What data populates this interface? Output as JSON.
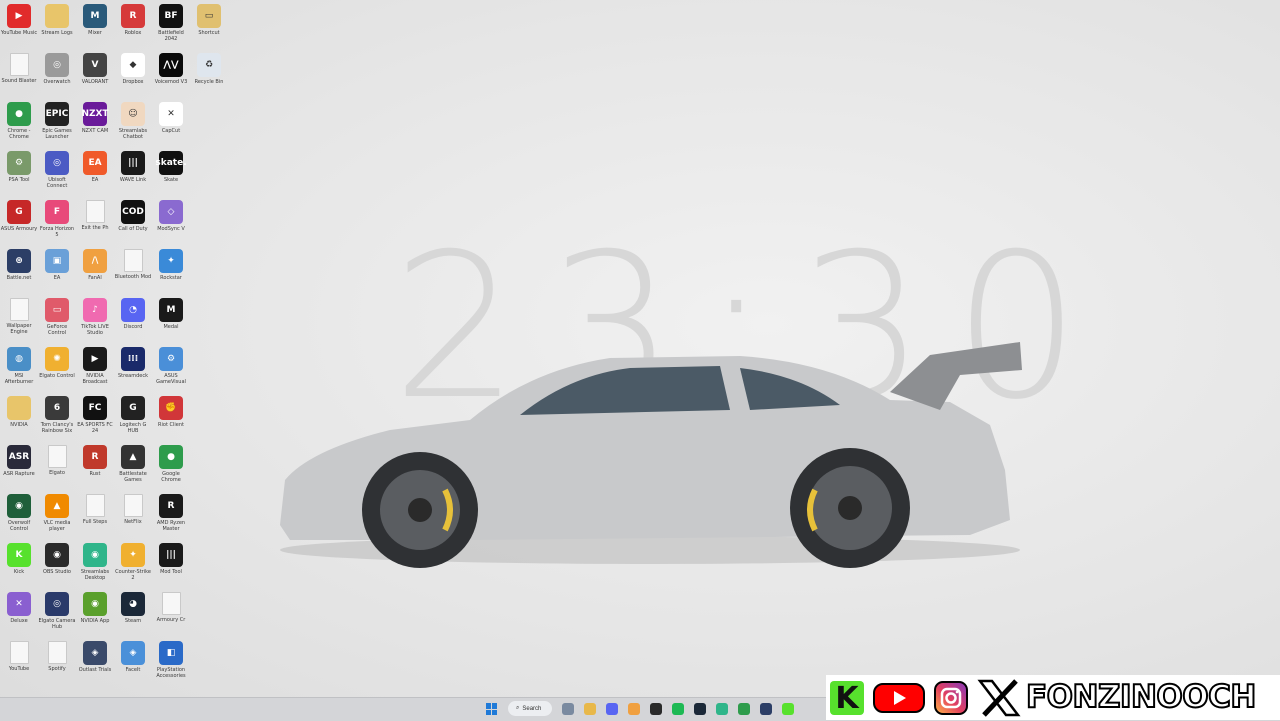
{
  "clock": {
    "time": "23:30"
  },
  "accent": "#1f7ad8",
  "desktop_icons": [
    {
      "label": "YouTube Music",
      "icon": "youtube-music-icon",
      "color": "#e12b2b",
      "text": "▶"
    },
    {
      "label": "Sound Blaster",
      "icon": "file-icon",
      "color": "",
      "text": ""
    },
    {
      "label": "Chrome - Chrome",
      "icon": "chrome-icon",
      "color": "#2e9c4c",
      "text": "●"
    },
    {
      "label": "PSA Tool",
      "icon": "tool-icon",
      "color": "#7a9a6a",
      "text": "⚙"
    },
    {
      "label": "ASUS Armoury",
      "icon": "asus-icon",
      "color": "#c62828",
      "text": "G"
    },
    {
      "label": "Battle.net",
      "icon": "battlenet-icon",
      "color": "#2c3e66",
      "text": "⊛"
    },
    {
      "label": "Wallpaper Engine",
      "icon": "file-icon",
      "color": "",
      "text": ""
    },
    {
      "label": "MSI Afterburner",
      "icon": "globe-icon",
      "color": "#4a8fc7",
      "text": "◍"
    },
    {
      "label": "NVIDIA",
      "icon": "folder-icon",
      "color": "#e8c56a",
      "text": ""
    },
    {
      "label": "ASR Rapture",
      "icon": "asr-icon",
      "color": "#2a2a3a",
      "text": "ASR"
    },
    {
      "label": "Overwolf Control",
      "icon": "overwolf-icon",
      "color": "#1f5f3a",
      "text": "◉"
    },
    {
      "label": "Kick",
      "icon": "kick-icon",
      "color": "#57e12d",
      "text": "K"
    },
    {
      "label": "Deluxe",
      "icon": "deluxe-icon",
      "color": "#8a5fd0",
      "text": "✕"
    },
    {
      "label": "YouTube",
      "icon": "file-icon",
      "color": "",
      "text": ""
    },
    {
      "label": "Stream Logs",
      "icon": "folder-icon",
      "color": "#e8c56a",
      "text": ""
    },
    {
      "label": "Overwatch",
      "icon": "overwatch-icon",
      "color": "#9a9a9a",
      "text": "◎"
    },
    {
      "label": "Epic Games Launcher",
      "icon": "epic-icon",
      "color": "#222222",
      "text": "EPIC"
    },
    {
      "label": "Ubisoft Connect",
      "icon": "ubisoft-icon",
      "color": "#4b5bc4",
      "text": "◎"
    },
    {
      "label": "Forza Horizon 5",
      "icon": "forza-icon",
      "color": "#e84a7a",
      "text": "F"
    },
    {
      "label": "EA",
      "icon": "image-icon",
      "color": "#6aa0d8",
      "text": "▣"
    },
    {
      "label": "GeForce Control",
      "icon": "monitor-icon",
      "color": "#e05a6a",
      "text": "▭"
    },
    {
      "label": "Elgato Control",
      "icon": "elgato-icon",
      "color": "#f0b030",
      "text": "✺"
    },
    {
      "label": "Tom Clancy's Rainbow Six",
      "icon": "r6-icon",
      "color": "#3a3a3a",
      "text": "6"
    },
    {
      "label": "Elgato",
      "icon": "file-icon",
      "color": "",
      "text": ""
    },
    {
      "label": "VLC media player",
      "icon": "vlc-icon",
      "color": "#f08a00",
      "text": "▲"
    },
    {
      "label": "OBS Studio",
      "icon": "obs-icon",
      "color": "#2a2a2a",
      "text": "◉"
    },
    {
      "label": "Elgato Camera Hub",
      "icon": "camera-hub-icon",
      "color": "#2a3a6a",
      "text": "◎"
    },
    {
      "label": "Spotify",
      "icon": "file-icon",
      "color": "",
      "text": ""
    },
    {
      "label": "Mixer",
      "icon": "mixer-icon",
      "color": "#2a5a7a",
      "text": "M"
    },
    {
      "label": "VALORANT",
      "icon": "valorant-icon",
      "color": "#444444",
      "text": "V"
    },
    {
      "label": "NZXT CAM",
      "icon": "nzxt-icon",
      "color": "#6a1a9a",
      "text": "NZXT"
    },
    {
      "label": "EA",
      "icon": "ea-icon",
      "color": "#f05a2a",
      "text": "EA"
    },
    {
      "label": "Exit the Ph",
      "icon": "file-icon",
      "color": "",
      "text": ""
    },
    {
      "label": "FanAl",
      "icon": "fanal-icon",
      "color": "#f0a040",
      "text": "/\\"
    },
    {
      "label": "TikTok LIVE Studio",
      "icon": "tiktok-icon",
      "color": "#f06ab0",
      "text": "♪"
    },
    {
      "label": "NVIDIA Broadcast",
      "icon": "nvidia-broadcast-icon",
      "color": "#1a1a1a",
      "text": "▶"
    },
    {
      "label": "EA SPORTS FC 24",
      "icon": "fc24-icon",
      "color": "#111111",
      "text": "FC"
    },
    {
      "label": "Rust",
      "icon": "rust-icon",
      "color": "#c0392b",
      "text": "R"
    },
    {
      "label": "Full Steps",
      "icon": "file-icon",
      "color": "",
      "text": ""
    },
    {
      "label": "Streamlabs Desktop",
      "icon": "streamlabs-icon",
      "color": "#2fb58a",
      "text": "◉"
    },
    {
      "label": "NVIDIA App",
      "icon": "nvidia-icon",
      "color": "#5aa02c",
      "text": "◉"
    },
    {
      "label": "Outlast Trials",
      "icon": "outlast-icon",
      "color": "#3a4a6a",
      "text": "◈"
    },
    {
      "label": "Roblox",
      "icon": "roblox-icon",
      "color": "#d63a3a",
      "text": "R"
    },
    {
      "label": "Dropbox",
      "icon": "dropbox-icon",
      "color": "#ffffff",
      "text": "◆"
    },
    {
      "label": "Streamlabs Chatbot",
      "icon": "chatbot-icon",
      "color": "#f0d8c0",
      "text": "☺"
    },
    {
      "label": "WAVE Link",
      "icon": "wavelink-icon",
      "color": "#1a1a1a",
      "text": "|||"
    },
    {
      "label": "Call of Duty",
      "icon": "cod-icon",
      "color": "#111111",
      "text": "COD"
    },
    {
      "label": "Bluetooth Mod",
      "icon": "file-icon",
      "color": "",
      "text": ""
    },
    {
      "label": "Discord",
      "icon": "discord-icon",
      "color": "#5865f2",
      "text": "◔"
    },
    {
      "label": "Streamdeck",
      "icon": "streamdeck-icon",
      "color": "#1a2a6a",
      "text": "⁞⁞⁞"
    },
    {
      "label": "Logitech G HUB",
      "icon": "ghub-icon",
      "color": "#222222",
      "text": "G"
    },
    {
      "label": "Battlestate Games",
      "icon": "bsg-icon",
      "color": "#333333",
      "text": "▲"
    },
    {
      "label": "NetFlix",
      "icon": "file-icon",
      "color": "",
      "text": ""
    },
    {
      "label": "Counter-Strike 2",
      "icon": "cs2-icon",
      "color": "#f0b030",
      "text": "✦"
    },
    {
      "label": "Steam",
      "icon": "steam-icon",
      "color": "#1b2838",
      "text": "◕"
    },
    {
      "label": "FaceIt",
      "icon": "faceit-icon",
      "color": "#4a90d9",
      "text": "◈"
    },
    {
      "label": "Battlefield 2042",
      "icon": "bf-icon",
      "color": "#111111",
      "text": "BF"
    },
    {
      "label": "Voicemod V3",
      "icon": "voicemod-icon",
      "color": "#0a0a0a",
      "text": "⋀⋁"
    },
    {
      "label": "CapCut",
      "icon": "capcut-icon",
      "color": "#ffffff",
      "text": "✕"
    },
    {
      "label": "Skate",
      "icon": "skate-icon",
      "color": "#111111",
      "text": "skate."
    },
    {
      "label": "ModSync V",
      "icon": "modsync-icon",
      "color": "#8a6ad0",
      "text": "◇"
    },
    {
      "label": "Rockstar",
      "icon": "rockstar-icon",
      "color": "#3a8ad8",
      "text": "✦"
    },
    {
      "label": "Medal",
      "icon": "medal-icon",
      "color": "#1a1a1a",
      "text": "M"
    },
    {
      "label": "ASUS GameVisual",
      "icon": "gear-icon",
      "color": "#4a8fd8",
      "text": "⚙"
    },
    {
      "label": "Riot Client",
      "icon": "riot-icon",
      "color": "#d13639",
      "text": "✊"
    },
    {
      "label": "Google Chrome",
      "icon": "chrome-icon",
      "color": "#2e9c4c",
      "text": "●"
    },
    {
      "label": "AMD Ryzen Master",
      "icon": "ryzen-icon",
      "color": "#1a1a1a",
      "text": "R"
    },
    {
      "label": "Mod Tool",
      "icon": "modtool-icon",
      "color": "#1a1a1a",
      "text": "|||"
    },
    {
      "label": "Armoury Cr",
      "icon": "file-icon",
      "color": "",
      "text": ""
    },
    {
      "label": "PlayStation Accessories",
      "icon": "playstation-icon",
      "color": "#2a6ac8",
      "text": "◧"
    },
    {
      "label": "Shortcut",
      "icon": "shortcut-icon",
      "color": "#e0c070",
      "text": "▭"
    },
    {
      "label": "Recycle Bin",
      "icon": "recycle-bin-icon",
      "color": "#dfe6ee",
      "text": "♻"
    }
  ],
  "taskbar": {
    "search_label": "Search",
    "apps": [
      {
        "icon": "settings-icon",
        "color": "#7a8aa0"
      },
      {
        "icon": "file-explorer-icon",
        "color": "#e8b84a"
      },
      {
        "icon": "discord-icon",
        "color": "#5865f2"
      },
      {
        "icon": "fanal-icon",
        "color": "#f0a040"
      },
      {
        "icon": "obs-icon",
        "color": "#2a2a2a"
      },
      {
        "icon": "spotify-icon",
        "color": "#1db954"
      },
      {
        "icon": "steam-icon",
        "color": "#1b2838"
      },
      {
        "icon": "streamlabs-icon",
        "color": "#2fb58a"
      },
      {
        "icon": "chrome-icon",
        "color": "#2e9c4c"
      },
      {
        "icon": "battlenet-icon",
        "color": "#2c3e66"
      },
      {
        "icon": "kick-icon",
        "color": "#57e12d"
      }
    ]
  },
  "social": {
    "handle": "FONZINOOCH",
    "kick_letter": "K"
  }
}
